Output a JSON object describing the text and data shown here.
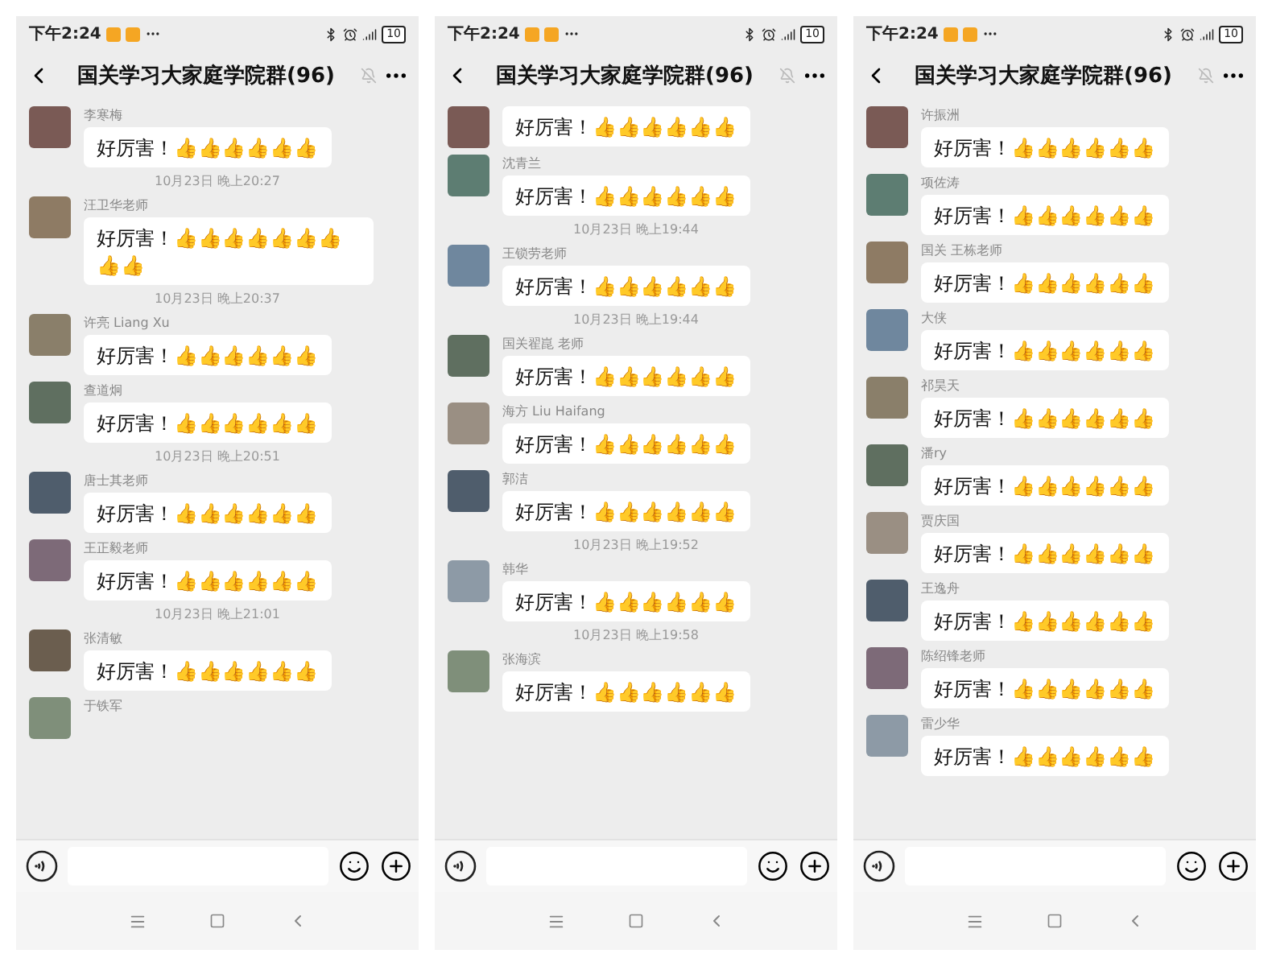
{
  "screens": [
    {
      "status_bar": {
        "time": "下午2:24",
        "battery": "10"
      },
      "header": {
        "title": "国关学习大家庭学院群(96)"
      },
      "messages": [
        {
          "kind": "message",
          "name": "李寒梅",
          "text": "好厉害！",
          "emoji": "👍👍👍👍👍👍"
        },
        {
          "kind": "timestamp",
          "text": "10月23日 晚上20:27"
        },
        {
          "kind": "message",
          "name": "汪卫华老师",
          "text": "好厉害！",
          "emoji": "👍👍👍👍👍👍👍👍👍"
        },
        {
          "kind": "timestamp",
          "text": "10月23日 晚上20:37"
        },
        {
          "kind": "message",
          "name": "许亮 Liang Xu",
          "text": "好厉害！",
          "emoji": "👍👍👍👍👍👍"
        },
        {
          "kind": "message",
          "name": "查道炯",
          "text": "好厉害！",
          "emoji": "👍👍👍👍👍👍"
        },
        {
          "kind": "timestamp",
          "text": "10月23日 晚上20:51"
        },
        {
          "kind": "message",
          "name": "唐士其老师",
          "text": "好厉害！",
          "emoji": "👍👍👍👍👍👍"
        },
        {
          "kind": "message",
          "name": "王正毅老师",
          "text": "好厉害！",
          "emoji": "👍👍👍👍👍👍"
        },
        {
          "kind": "timestamp",
          "text": "10月23日 晚上21:01"
        },
        {
          "kind": "message",
          "name": "张清敏",
          "text": "好厉害！",
          "emoji": "👍👍👍👍👍👍"
        },
        {
          "kind": "message",
          "name": "于铁军"
        }
      ]
    },
    {
      "status_bar": {
        "time": "下午2:24",
        "battery": "10"
      },
      "header": {
        "title": "国关学习大家庭学院群(96)"
      },
      "messages": [
        {
          "kind": "message",
          "text": "好厉害！",
          "emoji": "👍👍👍👍👍👍"
        },
        {
          "kind": "message",
          "name": "沈青兰",
          "text": "好厉害！",
          "emoji": "👍👍👍👍👍👍"
        },
        {
          "kind": "timestamp",
          "text": "10月23日 晚上19:44"
        },
        {
          "kind": "message",
          "name": "王锁劳老师",
          "text": "好厉害！",
          "emoji": "👍👍👍👍👍👍"
        },
        {
          "kind": "timestamp",
          "text": "10月23日 晚上19:44"
        },
        {
          "kind": "message",
          "name": "国关翟崑 老师",
          "text": "好厉害！",
          "emoji": "👍👍👍👍👍👍"
        },
        {
          "kind": "message",
          "name": "海方 Liu Haifang",
          "text": "好厉害！",
          "emoji": "👍👍👍👍👍👍"
        },
        {
          "kind": "message",
          "name": "郭洁",
          "text": "好厉害！",
          "emoji": "👍👍👍👍👍👍"
        },
        {
          "kind": "timestamp",
          "text": "10月23日 晚上19:52"
        },
        {
          "kind": "message",
          "name": "韩华",
          "text": "好厉害！",
          "emoji": "👍👍👍👍👍👍"
        },
        {
          "kind": "timestamp",
          "text": "10月23日 晚上19:58"
        },
        {
          "kind": "message",
          "name": "张海滨",
          "text": "好厉害！",
          "emoji": "👍👍👍👍👍👍"
        }
      ]
    },
    {
      "status_bar": {
        "time": "下午2:24",
        "battery": "10"
      },
      "header": {
        "title": "国关学习大家庭学院群(96)"
      },
      "messages": [
        {
          "kind": "message",
          "name": "许振洲",
          "text": "好厉害！",
          "emoji": "👍👍👍👍👍👍"
        },
        {
          "kind": "message",
          "name": "项佐涛",
          "text": "好厉害！",
          "emoji": "👍👍👍👍👍👍"
        },
        {
          "kind": "message",
          "name": "国关 王栋老师",
          "text": "好厉害！",
          "emoji": "👍👍👍👍👍👍"
        },
        {
          "kind": "message",
          "name": "大侠",
          "text": "好厉害！",
          "emoji": "👍👍👍👍👍👍"
        },
        {
          "kind": "message",
          "name": "祁昊天",
          "text": "好厉害！",
          "emoji": "👍👍👍👍👍👍"
        },
        {
          "kind": "message",
          "name": "潘ry",
          "text": "好厉害！",
          "emoji": "👍👍👍👍👍👍"
        },
        {
          "kind": "message",
          "name": "贾庆国",
          "text": "好厉害！",
          "emoji": "👍👍👍👍👍👍"
        },
        {
          "kind": "message",
          "name": "王逸舟",
          "text": "好厉害！",
          "emoji": "👍👍👍👍👍👍"
        },
        {
          "kind": "message",
          "name": "陈绍锋老师",
          "text": "好厉害！",
          "emoji": "👍👍👍👍👍👍"
        },
        {
          "kind": "message",
          "name": "雷少华",
          "text": "好厉害！",
          "emoji": "👍👍👍👍👍👍"
        }
      ]
    }
  ]
}
